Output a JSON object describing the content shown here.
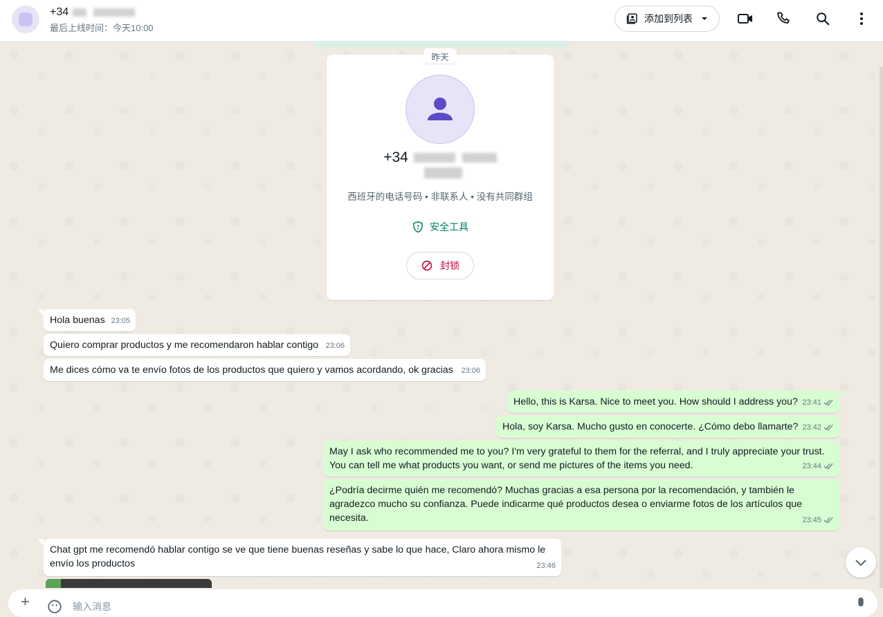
{
  "header": {
    "contact_prefix": "+34",
    "status": "最后上线时间：今天10:00",
    "add_to_list_label": "添加到列表",
    "icons": [
      "video-call-icon",
      "voice-call-icon",
      "search-icon",
      "more-options-icon"
    ]
  },
  "chat": {
    "date_chip": "昨天",
    "contact_card": {
      "number_prefix": "+34",
      "info": "西班牙的电话号码 • 非联系人 • 没有共同群组",
      "safety_tools_label": "安全工具",
      "block_label": "封锁"
    },
    "messages": [
      {
        "dir": "in",
        "text": "Hola buenas",
        "time": "23:05"
      },
      {
        "dir": "in",
        "text": "Quiero comprar productos y me recomendaron hablar contigo",
        "time": "23:06"
      },
      {
        "dir": "in",
        "text": "Me dices cómo va te envío fotos de los productos que quiero y vamos acordando, ok gracias",
        "time": "23:06"
      },
      {
        "dir": "out",
        "text": "Hello, this is Karsa. Nice to meet you. How should I address you?",
        "time": "23:41"
      },
      {
        "dir": "out",
        "text": "Hola, soy Karsa. Mucho gusto en conocerte. ¿Cómo debo llamarte?",
        "time": "23:42"
      },
      {
        "dir": "out",
        "text": "May I ask who recommended me to you? I'm very grateful to them for the referral, and I truly appreciate your trust. You can tell me what products you want, or send me pictures of the items you need.",
        "time": "23:44"
      },
      {
        "dir": "out",
        "text": "¿Podría decirme quién me recomendó? Muchas gracias a esa persona por la recomendación, y también le agradezco mucho su confianza. Puede indicarme qué productos desea o enviarme fotos de los artículos que necesita.",
        "time": "23:45"
      },
      {
        "dir": "in",
        "text": "Chat gpt me recomendó hablar contigo se ve que tiene buenas reseñas y sabe lo que hace,  Claro ahora mismo le envío los productos",
        "time": "23:46"
      }
    ]
  },
  "composer": {
    "placeholder": "输入消息"
  },
  "colors": {
    "accent": "#008069",
    "outgoing_bubble": "#d9fdd3",
    "block_red": "#c1123f",
    "avatar_purple": "#5b4bc4"
  }
}
